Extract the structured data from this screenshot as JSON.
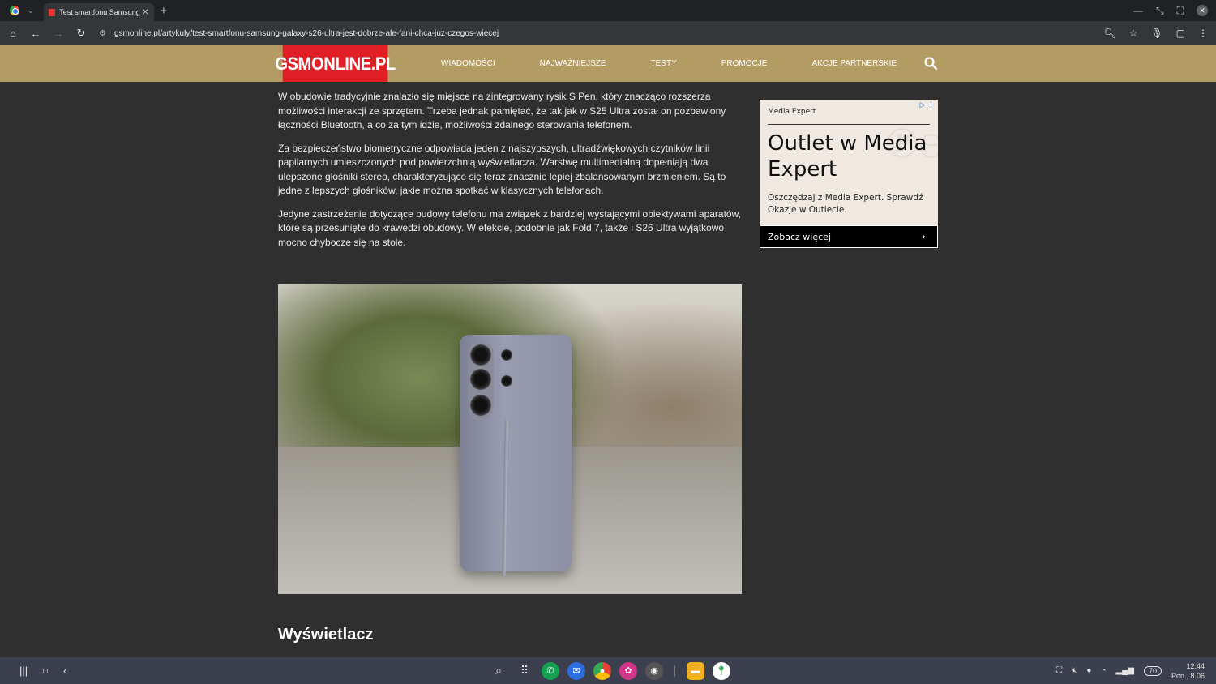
{
  "browser": {
    "tab_title": "Test smartfonu Samsung G",
    "url": "gsmonline.pl/artykuly/test-smartfonu-samsung-galaxy-s26-ultra-jest-dobrze-ale-fani-chca-juz-czegos-wiecej"
  },
  "site": {
    "logo": "GSMONLINE.PL",
    "nav": [
      "WIADOMOŚCI",
      "NAJWAŻNIEJSZE",
      "TESTY",
      "PROMOCJE",
      "AKCJE PARTNERSKIE"
    ]
  },
  "article": {
    "paragraphs": [
      "W obudowie tradycyjnie znalazło się miejsce na zintegrowany rysik S Pen, który znacząco rozszerza możliwości interakcji ze sprzętem. Trzeba jednak pamiętać, że tak jak w S25 Ultra został on pozbawiony łączności Bluetooth, a co za tym idzie, możliwości zdalnego sterowania telefonem.",
      "Za bezpieczeństwo biometryczne odpowiada jeden z najszybszych, ultradźwiękowych czytników linii papilarnych umieszczonych pod powierzchnią wyświetlacza. Warstwę multimedialną dopełniają dwa ulepszone głośniki stereo, charakteryzujące się teraz znacznie lepiej zbalansowanym brzmieniem. Są to jedne z lepszych głośników, jakie można spotkać w klasycznych telefonach.",
      "Jedyne zastrzeżenie dotyczące budowy telefonu ma związek z bardziej wystającymi obiektywami aparatów, które są przesunięte do krawędzi obudowy. W efekcie, podobnie jak Fold 7, także i S26 Ultra wyjątkowo mocno chybocze się na stole."
    ],
    "section_heading": "Wyświetlacz"
  },
  "ad": {
    "brand": "Media Expert",
    "headline": "Outlet w Media Expert",
    "body": "Oszczędzaj z Media Expert. Sprawdź Okazje w Outlecie.",
    "cta": "Zobacz więcej"
  },
  "taskbar": {
    "battery": "70",
    "time": "12:44",
    "date": "Pon., 8.06"
  }
}
